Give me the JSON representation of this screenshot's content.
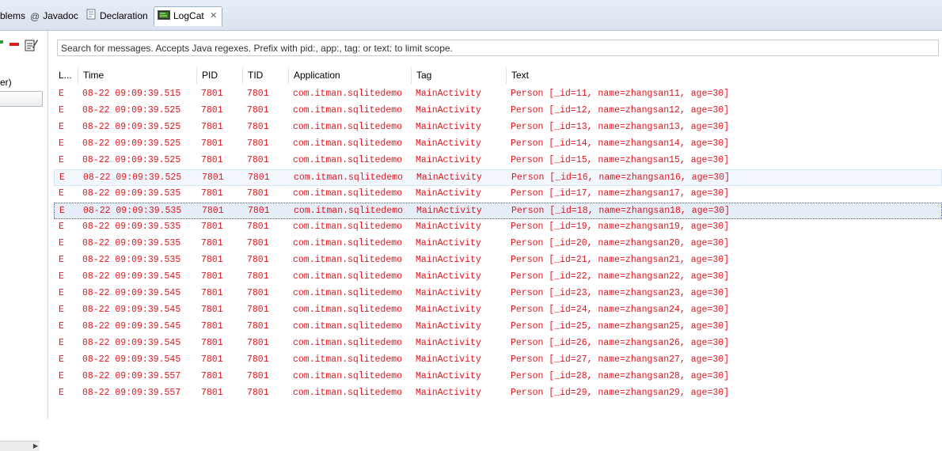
{
  "tabs": [
    {
      "label": "blems",
      "icon": "problems-icon"
    },
    {
      "label": "Javadoc",
      "icon": "at-icon"
    },
    {
      "label": "Declaration",
      "icon": "declaration-icon"
    },
    {
      "label": "LogCat",
      "icon": "logcat-icon",
      "active": true
    }
  ],
  "left_panel": {
    "label": "er)",
    "toolbar": [
      "add-filter-icon",
      "remove-filter-icon",
      "edit-filter-icon"
    ]
  },
  "search": {
    "placeholder": "Search for messages. Accepts Java regexes. Prefix with pid:, app:, tag: or text: to limit scope."
  },
  "columns": [
    "L...",
    "Time",
    "PID",
    "TID",
    "Application",
    "Tag",
    "Text"
  ],
  "rows": [
    {
      "level": "E",
      "time": "08-22 09:09:39.515",
      "pid": "7801",
      "tid": "7801",
      "app": "com.itman.sqlitedemo",
      "tag": "MainActivity",
      "text": "Person [_id=11, name=zhangsan11, age=30]"
    },
    {
      "level": "E",
      "time": "08-22 09:09:39.525",
      "pid": "7801",
      "tid": "7801",
      "app": "com.itman.sqlitedemo",
      "tag": "MainActivity",
      "text": "Person [_id=12, name=zhangsan12, age=30]"
    },
    {
      "level": "E",
      "time": "08-22 09:09:39.525",
      "pid": "7801",
      "tid": "7801",
      "app": "com.itman.sqlitedemo",
      "tag": "MainActivity",
      "text": "Person [_id=13, name=zhangsan13, age=30]"
    },
    {
      "level": "E",
      "time": "08-22 09:09:39.525",
      "pid": "7801",
      "tid": "7801",
      "app": "com.itman.sqlitedemo",
      "tag": "MainActivity",
      "text": "Person [_id=14, name=zhangsan14, age=30]"
    },
    {
      "level": "E",
      "time": "08-22 09:09:39.525",
      "pid": "7801",
      "tid": "7801",
      "app": "com.itman.sqlitedemo",
      "tag": "MainActivity",
      "text": "Person [_id=15, name=zhangsan15, age=30]"
    },
    {
      "level": "E",
      "time": "08-22 09:09:39.525",
      "pid": "7801",
      "tid": "7801",
      "app": "com.itman.sqlitedemo",
      "tag": "MainActivity",
      "text": "Person [_id=16, name=zhangsan16, age=30]"
    },
    {
      "level": "E",
      "time": "08-22 09:09:39.535",
      "pid": "7801",
      "tid": "7801",
      "app": "com.itman.sqlitedemo",
      "tag": "MainActivity",
      "text": "Person [_id=17, name=zhangsan17, age=30]"
    },
    {
      "level": "E",
      "time": "08-22 09:09:39.535",
      "pid": "7801",
      "tid": "7801",
      "app": "com.itman.sqlitedemo",
      "tag": "MainActivity",
      "text": "Person [_id=18, name=zhangsan18, age=30]"
    },
    {
      "level": "E",
      "time": "08-22 09:09:39.535",
      "pid": "7801",
      "tid": "7801",
      "app": "com.itman.sqlitedemo",
      "tag": "MainActivity",
      "text": "Person [_id=19, name=zhangsan19, age=30]"
    },
    {
      "level": "E",
      "time": "08-22 09:09:39.535",
      "pid": "7801",
      "tid": "7801",
      "app": "com.itman.sqlitedemo",
      "tag": "MainActivity",
      "text": "Person [_id=20, name=zhangsan20, age=30]"
    },
    {
      "level": "E",
      "time": "08-22 09:09:39.535",
      "pid": "7801",
      "tid": "7801",
      "app": "com.itman.sqlitedemo",
      "tag": "MainActivity",
      "text": "Person [_id=21, name=zhangsan21, age=30]"
    },
    {
      "level": "E",
      "time": "08-22 09:09:39.545",
      "pid": "7801",
      "tid": "7801",
      "app": "com.itman.sqlitedemo",
      "tag": "MainActivity",
      "text": "Person [_id=22, name=zhangsan22, age=30]"
    },
    {
      "level": "E",
      "time": "08-22 09:09:39.545",
      "pid": "7801",
      "tid": "7801",
      "app": "com.itman.sqlitedemo",
      "tag": "MainActivity",
      "text": "Person [_id=23, name=zhangsan23, age=30]"
    },
    {
      "level": "E",
      "time": "08-22 09:09:39.545",
      "pid": "7801",
      "tid": "7801",
      "app": "com.itman.sqlitedemo",
      "tag": "MainActivity",
      "text": "Person [_id=24, name=zhangsan24, age=30]"
    },
    {
      "level": "E",
      "time": "08-22 09:09:39.545",
      "pid": "7801",
      "tid": "7801",
      "app": "com.itman.sqlitedemo",
      "tag": "MainActivity",
      "text": "Person [_id=25, name=zhangsan25, age=30]"
    },
    {
      "level": "E",
      "time": "08-22 09:09:39.545",
      "pid": "7801",
      "tid": "7801",
      "app": "com.itman.sqlitedemo",
      "tag": "MainActivity",
      "text": "Person [_id=26, name=zhangsan26, age=30]"
    },
    {
      "level": "E",
      "time": "08-22 09:09:39.545",
      "pid": "7801",
      "tid": "7801",
      "app": "com.itman.sqlitedemo",
      "tag": "MainActivity",
      "text": "Person [_id=27, name=zhangsan27, age=30]"
    },
    {
      "level": "E",
      "time": "08-22 09:09:39.557",
      "pid": "7801",
      "tid": "7801",
      "app": "com.itman.sqlitedemo",
      "tag": "MainActivity",
      "text": "Person [_id=28, name=zhangsan28, age=30]"
    },
    {
      "level": "E",
      "time": "08-22 09:09:39.557",
      "pid": "7801",
      "tid": "7801",
      "app": "com.itman.sqlitedemo",
      "tag": "MainActivity",
      "text": "Person [_id=29, name=zhangsan29, age=30]"
    }
  ],
  "hover_row": 5,
  "selected_row": 7,
  "colors": {
    "error_text": "#e0161e",
    "selection": "#e6eef9",
    "tabbar": "#dfe7f1"
  }
}
